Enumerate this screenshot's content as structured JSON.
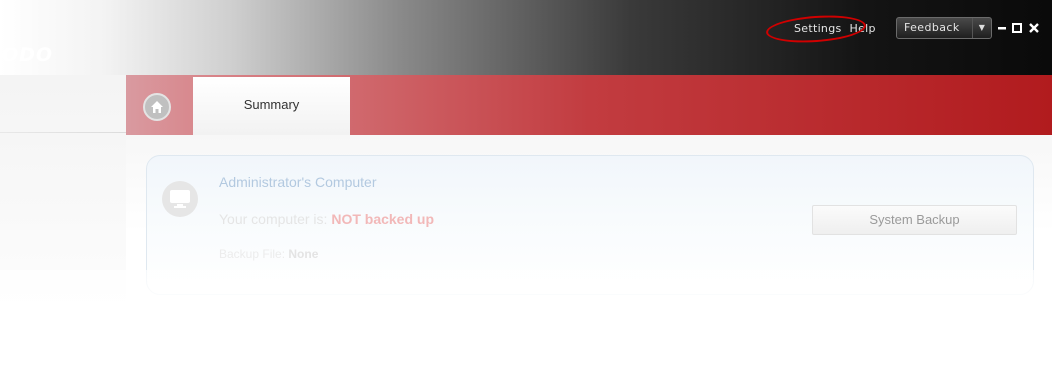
{
  "brand": "ODO",
  "menu": {
    "settings": "Settings",
    "help": "Help",
    "feedback": "Feedback"
  },
  "window_controls": [
    "minimize-icon",
    "maximize-icon",
    "close-icon"
  ],
  "tabs": {
    "summary": "Summary"
  },
  "card": {
    "computer_name": "Administrator's Computer",
    "status_prefix": "Your computer is:",
    "status_value": "NOT backed up",
    "backup_file_label": "Backup File:",
    "backup_file_value": "None",
    "system_backup_label": "System Backup"
  },
  "colors": {
    "tabbar_accent": "#b11b1e",
    "status_warning": "#f2b8b8",
    "highlight_circle": "#d10000"
  }
}
